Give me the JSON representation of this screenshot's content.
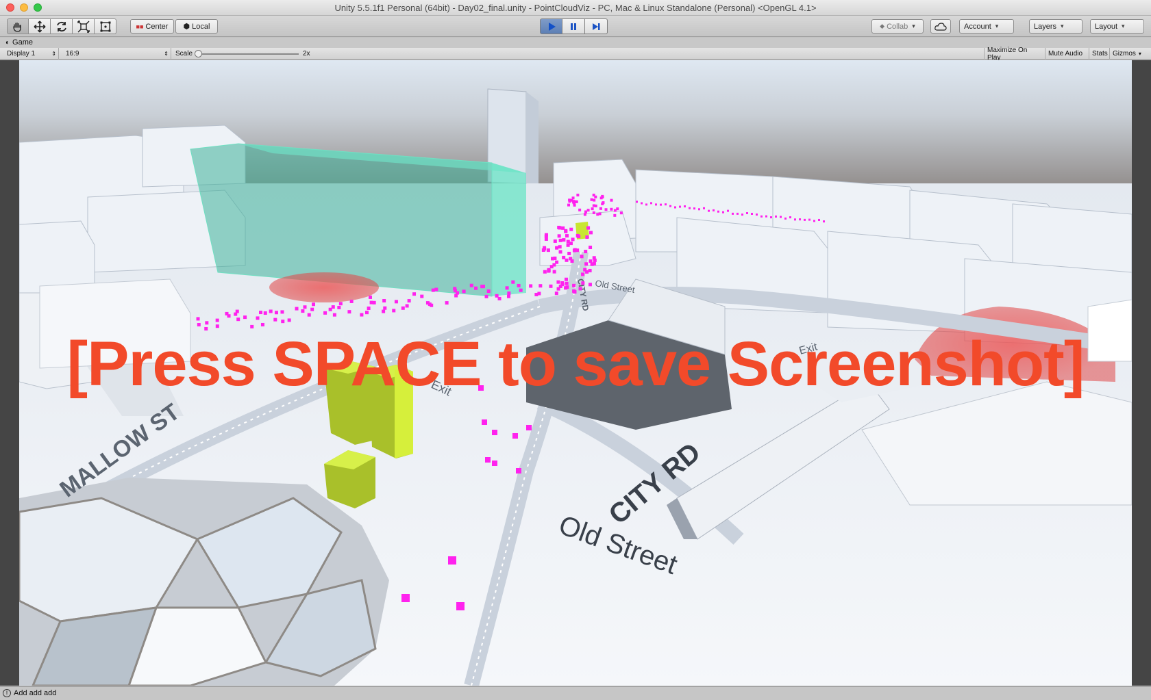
{
  "window": {
    "title": "Unity 5.5.1f1 Personal (64bit) - Day02_final.unity - PointCloudViz - PC, Mac & Linux Standalone (Personal) <OpenGL 4.1>"
  },
  "toolbar": {
    "tools": [
      "hand-tool",
      "move-tool",
      "rotate-tool",
      "scale-tool",
      "rect-tool"
    ],
    "pivot_label": "Center",
    "space_label": "Local",
    "collab_label": "Collab",
    "account_label": "Account",
    "layers_label": "Layers",
    "layout_label": "Layout",
    "play_color": "#5d7fb5"
  },
  "game_panel": {
    "tab_label": "Game",
    "display": "Display 1",
    "aspect": "16:9",
    "scale_label": "Scale",
    "scale_value": "2x",
    "maximize_label": "Maximize On Play",
    "mute_label": "Mute Audio",
    "stats_label": "Stats",
    "gizmos_label": "Gizmos"
  },
  "scene": {
    "overlay_text": "[Press SPACE to save Screenshot]",
    "overlay_color": "#f24a2a",
    "street_labels": [
      "MALLOW ST",
      "Old Street",
      "CITY RD",
      "Exit",
      "CITY RD",
      "Old Street",
      "Exit"
    ],
    "point_color": "#ff22ee",
    "highlight_building_color": "#5fd3b0",
    "marker_color": "#c8e632",
    "zone_color": "#e04b4b"
  },
  "status": {
    "message": "Add add add"
  }
}
